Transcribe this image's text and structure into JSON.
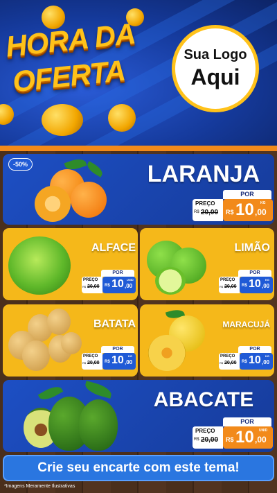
{
  "header": {
    "title_line1": "HORA DA",
    "title_line2": "OFERTA",
    "logo_line1": "Sua Logo",
    "logo_line2": "Aqui"
  },
  "products": [
    {
      "name": "LARANJA",
      "badge": "-50%",
      "por_label": "POR",
      "preco_label": "PREÇO",
      "old_prefix": "R$",
      "old_price": "20,00",
      "currency": "R$",
      "price_int": "10",
      "price_dec": ",00",
      "unit": "KG"
    },
    {
      "name": "ALFACE",
      "por_label": "POR",
      "preco_label": "PREÇO",
      "old_prefix": "R$",
      "old_price": "20,00",
      "currency": "R$",
      "price_int": "10",
      "price_dec": ",00",
      "unit": "UNID"
    },
    {
      "name": "LIMÃO",
      "por_label": "POR",
      "preco_label": "PREÇO",
      "old_prefix": "R$",
      "old_price": "20,00",
      "currency": "R$",
      "price_int": "10",
      "price_dec": ",00",
      "unit": "KG"
    },
    {
      "name": "BATATA",
      "por_label": "POR",
      "preco_label": "PREÇO",
      "old_prefix": "R$",
      "old_price": "20,00",
      "currency": "R$",
      "price_int": "10",
      "price_dec": ",00",
      "unit": "KG"
    },
    {
      "name": "MARACUJÁ",
      "por_label": "POR",
      "preco_label": "PREÇO",
      "old_prefix": "R$",
      "old_price": "20,00",
      "currency": "R$",
      "price_int": "10",
      "price_dec": ",00",
      "unit": "KG"
    },
    {
      "name": "ABACATE",
      "por_label": "POR",
      "preco_label": "PREÇO",
      "old_prefix": "R$",
      "old_price": "20,00",
      "currency": "R$",
      "price_int": "10",
      "price_dec": ",00",
      "unit": "UNID"
    }
  ],
  "cta": {
    "label": "Crie seu encarte com este tema!"
  },
  "footer": {
    "disclaimer": "*Imagens Meramente Ilustrativas"
  },
  "colors": {
    "blue_card": "#1d4fc4",
    "yellow_card": "#f5b81a",
    "price_orange": "#f28a1a",
    "title_yellow": "#ffc21a"
  }
}
